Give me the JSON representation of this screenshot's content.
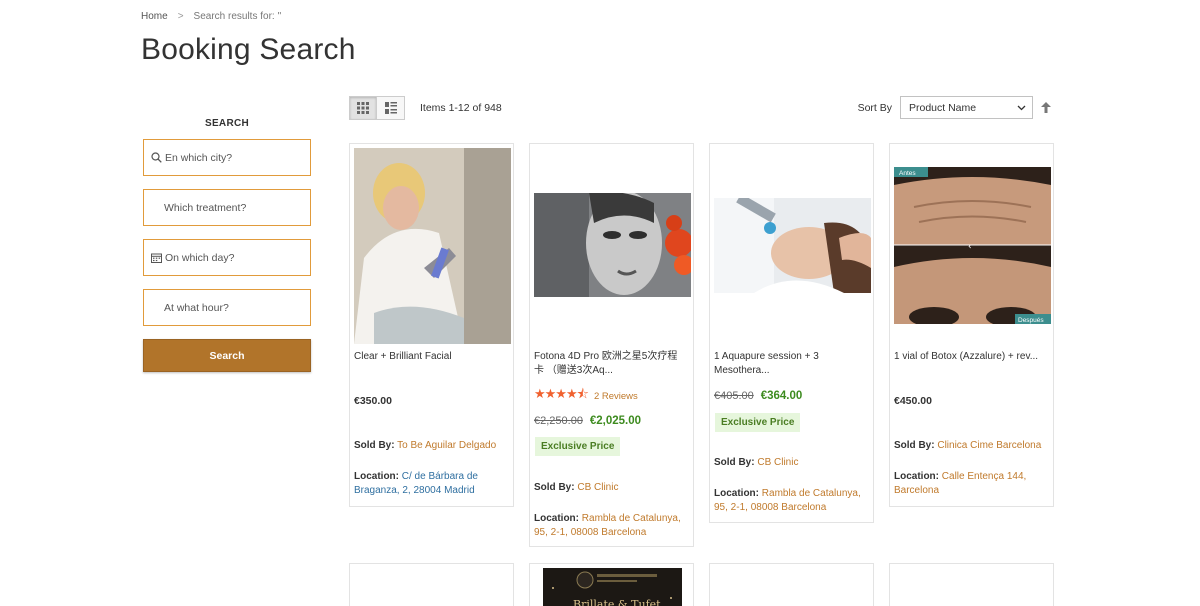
{
  "breadcrumb": {
    "home": "Home",
    "separator": ">",
    "current": "Search results for: ''"
  },
  "page_title": "Booking Search",
  "sidebar": {
    "title": "SEARCH",
    "fields": [
      {
        "placeholder": "En which city?",
        "icon": "search-icon"
      },
      {
        "placeholder": "Which treatment?",
        "icon": ""
      },
      {
        "placeholder": "On which day?",
        "icon": "calendar-icon"
      },
      {
        "placeholder": "At what hour?",
        "icon": ""
      }
    ],
    "button": "Search"
  },
  "toolbar": {
    "items_count": "Items 1-12 of 948",
    "sort_label": "Sort By",
    "sort_value": "Product Name",
    "modes": [
      "grid-icon",
      "list-icon"
    ],
    "sort_direction_icon": "arrow-up-icon"
  },
  "products": [
    {
      "name": "Clear + Brilliant Facial",
      "price": "€350.00",
      "sold_by_label": "Sold By:",
      "sold_by": "To Be Aguilar Delgado",
      "location_label": "Location:",
      "location": "C/ de Bárbara de Braganza, 2, 28004 Madrid"
    },
    {
      "name": "Fotona 4D Pro 欧洲之星5次疗程卡 （赠送3次Aq...",
      "rating_value": 4.5,
      "reviews": "2 Reviews",
      "old_price": "€2,250.00",
      "special_price": "€2,025.00",
      "badge": "Exclusive Price",
      "sold_by_label": "Sold By:",
      "sold_by": "CB Clinic",
      "location_label": "Location:",
      "location": "Rambla de Catalunya, 95, 2-1, 08008 Barcelona"
    },
    {
      "name": "1 Aquapure session + 3 Mesothera...",
      "old_price": "€405.00",
      "special_price": "€364.00",
      "badge": "Exclusive Price",
      "sold_by_label": "Sold By:",
      "sold_by": "CB Clinic",
      "location_label": "Location:",
      "location": "Rambla de Catalunya, 95, 2-1, 08008 Barcelona"
    },
    {
      "name": "1 vial of Botox (Azzalure) + rev...",
      "price": "€450.00",
      "image_labels": [
        "Antes",
        "Después"
      ],
      "sold_by_label": "Sold By:",
      "sold_by": "Clinica Cime Barcelona",
      "location_label": "Location:",
      "location": "Calle Entença 144, Barcelona"
    }
  ],
  "second_row": {
    "banner_text": "Brillate & Tufet"
  },
  "colors": {
    "accent": "#b1742a",
    "field_border": "#e19b3b",
    "link": "#c07a2c",
    "special_price": "#3d8b1f",
    "badge_bg": "#e6f6dc",
    "stars": "#f0612f"
  }
}
